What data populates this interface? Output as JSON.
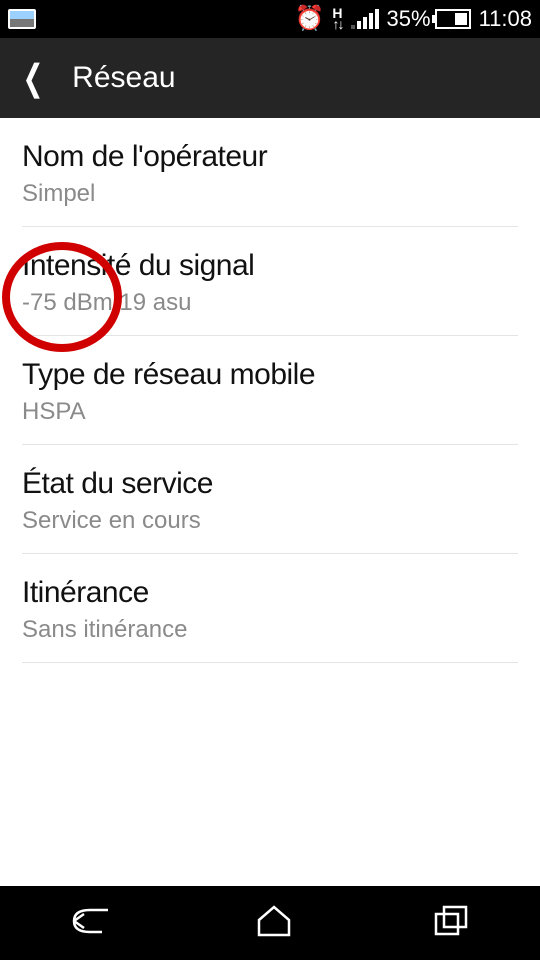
{
  "status": {
    "battery_pct": "35%",
    "time": "11:08",
    "data_indicator": "H"
  },
  "header": {
    "title": "Réseau"
  },
  "rows": {
    "operator": {
      "title": "Nom de l'opérateur",
      "value": "Simpel"
    },
    "signal": {
      "title": "Intensité du signal",
      "value": "-75 dBm   19 asu"
    },
    "nettype": {
      "title": "Type de réseau mobile",
      "value": "HSPA"
    },
    "service": {
      "title": "État du service",
      "value": "Service en cours"
    },
    "roaming": {
      "title": "Itinérance",
      "value": "Sans itinérance"
    }
  },
  "annotation": {
    "highlight_signal_dbm": true
  }
}
